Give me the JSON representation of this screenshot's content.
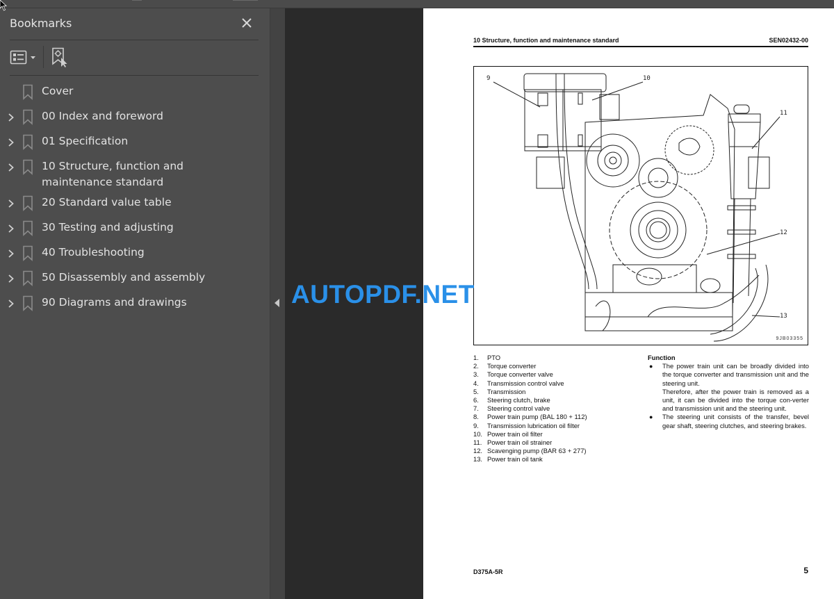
{
  "bookmarks_panel": {
    "title": "Bookmarks",
    "close_icon": "close-icon",
    "toolbar": {
      "options_icon": "list-options-icon",
      "options_dropdown_icon": "caret-down-icon",
      "find_current_icon": "find-current-bookmark-icon"
    },
    "items": [
      {
        "label": "Cover",
        "expandable": false
      },
      {
        "label": "00 Index and foreword",
        "expandable": true
      },
      {
        "label": "01 Specification",
        "expandable": true
      },
      {
        "label": "10 Structure, function and maintenance standard",
        "expandable": true
      },
      {
        "label": "20 Standard value table",
        "expandable": true
      },
      {
        "label": "30 Testing and adjusting",
        "expandable": true
      },
      {
        "label": "40 Troubleshooting",
        "expandable": true
      },
      {
        "label": "50 Disassembly and assembly",
        "expandable": true
      },
      {
        "label": "90 Diagrams and drawings",
        "expandable": true
      }
    ]
  },
  "collapse_handle_icon": "triangle-left-icon",
  "watermark": "AUTOPDF.NET",
  "document_page": {
    "header_left": "10 Structure, function and maintenance standard",
    "header_right": "SEN02432-00",
    "figure": {
      "code": "9JB03355",
      "callouts": [
        "9",
        "10",
        "11",
        "12",
        "13"
      ]
    },
    "parts": [
      {
        "num": "1.",
        "name": "PTO"
      },
      {
        "num": "2.",
        "name": "Torque converter"
      },
      {
        "num": "3.",
        "name": "Torque converter valve"
      },
      {
        "num": "4.",
        "name": "Transmission control valve"
      },
      {
        "num": "5.",
        "name": "Transmission"
      },
      {
        "num": "6.",
        "name": "Steering clutch, brake"
      },
      {
        "num": "7.",
        "name": "Steering control valve"
      },
      {
        "num": "8.",
        "name": "Power train pump (BAL 180 + 112)"
      },
      {
        "num": "9.",
        "name": "Transmission lubrication oil filter"
      },
      {
        "num": "10.",
        "name": "Power train oil filter"
      },
      {
        "num": "11.",
        "name": "Power train oil strainer"
      },
      {
        "num": "12.",
        "name": "Scavenging pump (BAR 63 + 277)"
      },
      {
        "num": "13.",
        "name": "Power train oil tank"
      }
    ],
    "function": {
      "heading": "Function",
      "bullet_1_p1": "The power train unit can be broadly divided into the torque converter and transmission unit and the steering unit.",
      "bullet_1_p2": "Therefore, after the power train is removed as a unit, it can be divided into the torque con-verter and transmission unit and the steering unit.",
      "bullet_2": "The steering unit consists of the transfer, bevel gear shaft, steering clutches, and steering brakes."
    },
    "footer_left": "D375A-5R",
    "page_number": "5"
  }
}
